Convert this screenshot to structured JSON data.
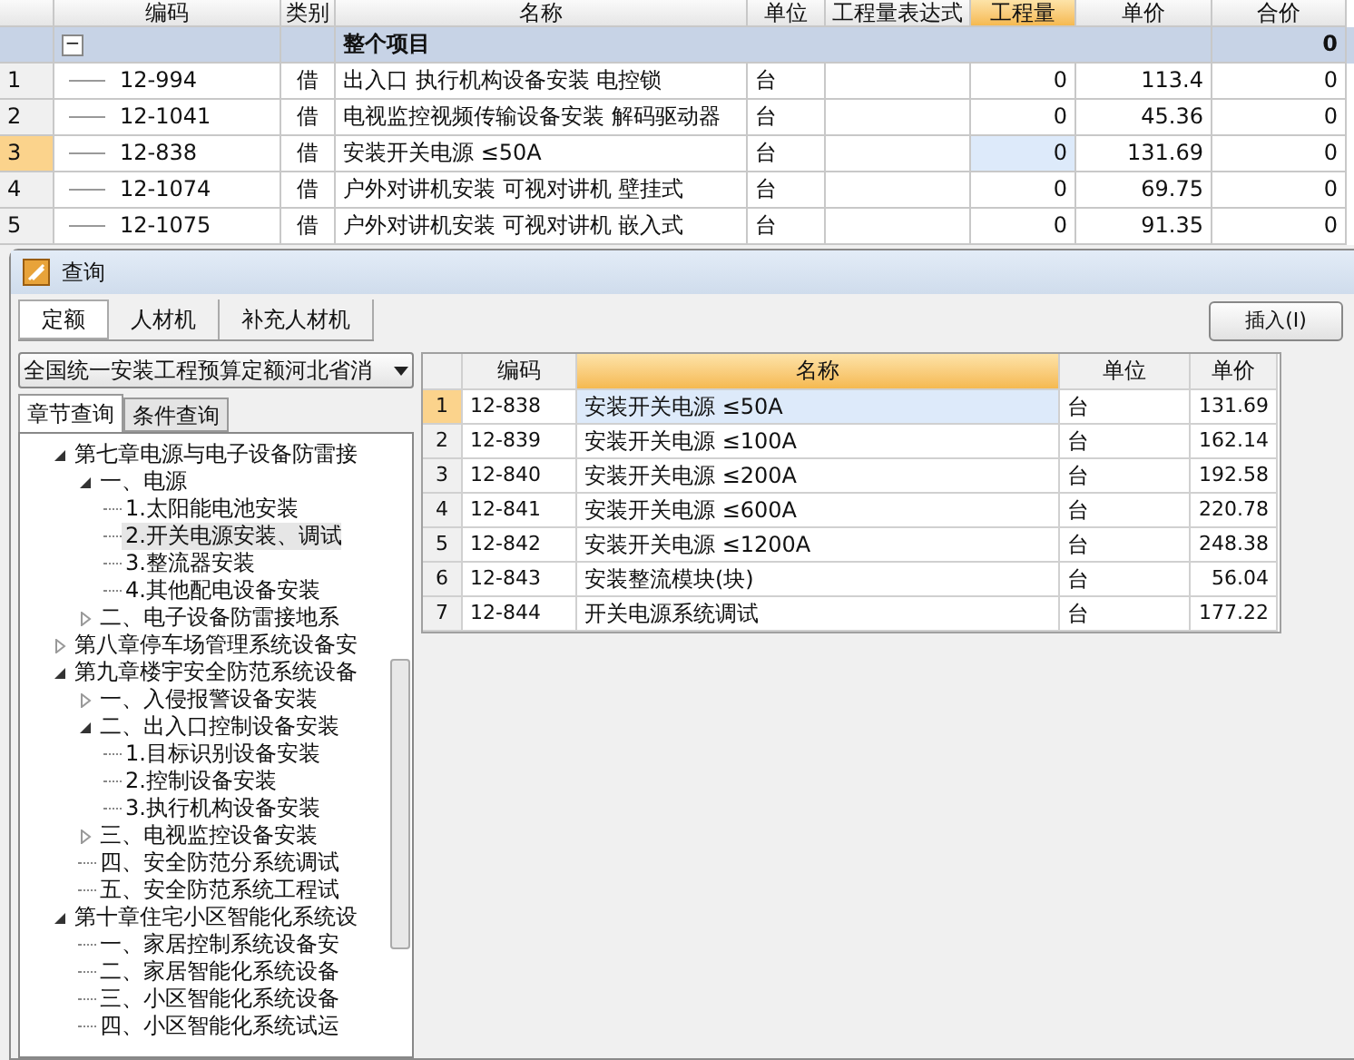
{
  "project_table": {
    "columns": [
      {
        "label": "编码",
        "selected": false
      },
      {
        "label": "类别",
        "selected": false
      },
      {
        "label": "名称",
        "selected": false
      },
      {
        "label": "单位",
        "selected": false
      },
      {
        "label": "工程量表达式",
        "selected": false
      },
      {
        "label": "工程量",
        "selected": true
      },
      {
        "label": "单价",
        "selected": false
      },
      {
        "label": "合价",
        "selected": false
      }
    ],
    "group": {
      "toggle": "−",
      "name": "整个项目",
      "total": "0"
    },
    "rows": [
      {
        "num": "1",
        "code": "12-994",
        "type": "借",
        "name": "出入口 执行机构设备安装 电控锁",
        "unit": "台",
        "qty": "0",
        "price": "113.4",
        "total": "0",
        "selected": false
      },
      {
        "num": "2",
        "code": "12-1041",
        "type": "借",
        "name": "电视监控视频传输设备安装 解码驱动器",
        "unit": "台",
        "qty": "0",
        "price": "45.36",
        "total": "0",
        "selected": false
      },
      {
        "num": "3",
        "code": "12-838",
        "type": "借",
        "name": "安装开关电源 ≤50A",
        "unit": "台",
        "qty": "0",
        "price": "131.69",
        "total": "0",
        "selected": true
      },
      {
        "num": "4",
        "code": "12-1074",
        "type": "借",
        "name": "户外对讲机安装 可视对讲机 壁挂式",
        "unit": "台",
        "qty": "0",
        "price": "69.75",
        "total": "0",
        "selected": false
      },
      {
        "num": "5",
        "code": "12-1075",
        "type": "借",
        "name": "户外对讲机安装 可视对讲机 嵌入式",
        "unit": "台",
        "qty": "0",
        "price": "91.35",
        "total": "0",
        "selected": false
      }
    ]
  },
  "dialog": {
    "title": "查询",
    "tabs": [
      {
        "label": "定额",
        "selected": true
      },
      {
        "label": "人材机",
        "selected": false
      },
      {
        "label": "补充人材机",
        "selected": false
      }
    ],
    "insert_button": "插入(I)",
    "library": "全国统一安装工程预算定额河北省消",
    "query_tabs": [
      {
        "label": "章节查询",
        "selected": true
      },
      {
        "label": "条件查询",
        "selected": false
      }
    ],
    "tree": [
      {
        "label": "第七章电源与电子设备防雷接",
        "expanded": true,
        "children": [
          {
            "label": "一、电源",
            "expanded": true,
            "children": [
              {
                "label": "1.太阳能电池安装",
                "selected": false
              },
              {
                "label": "2.开关电源安装、调试",
                "selected": true
              },
              {
                "label": "3.整流器安装",
                "selected": false
              },
              {
                "label": "4.其他配电设备安装",
                "selected": false
              }
            ]
          },
          {
            "label": "二、电子设备防雷接地系",
            "expanded": false
          }
        ]
      },
      {
        "label": "第八章停车场管理系统设备安",
        "expanded": false
      },
      {
        "label": "第九章楼宇安全防范系统设备",
        "expanded": true,
        "children": [
          {
            "label": "一、入侵报警设备安装",
            "expanded": false
          },
          {
            "label": "二、出入口控制设备安装",
            "expanded": true,
            "children": [
              {
                "label": "1.目标识别设备安装",
                "selected": false
              },
              {
                "label": "2.控制设备安装",
                "selected": false
              },
              {
                "label": "3.执行机构设备安装",
                "selected": false
              }
            ]
          },
          {
            "label": "三、电视监控设备安装",
            "expanded": false
          },
          {
            "label": "四、安全防范分系统调试",
            "selected": false
          },
          {
            "label": "五、安全防范系统工程试",
            "selected": false
          }
        ]
      },
      {
        "label": "第十章住宅小区智能化系统设",
        "expanded": true,
        "children": [
          {
            "label": "一、家居控制系统设备安",
            "selected": false
          },
          {
            "label": "二、家居智能化系统设备",
            "selected": false
          },
          {
            "label": "三、小区智能化系统设备",
            "selected": false
          },
          {
            "label": "四、小区智能化系统试运",
            "selected": false
          }
        ]
      }
    ],
    "results": {
      "columns": [
        {
          "label": "编码",
          "selected": false
        },
        {
          "label": "名称",
          "selected": true
        },
        {
          "label": "单位",
          "selected": false
        },
        {
          "label": "单价",
          "selected": false
        }
      ],
      "rows": [
        {
          "num": "1",
          "code": "12-838",
          "name": "安装开关电源 ≤50A",
          "unit": "台",
          "price": "131.69",
          "selected": true
        },
        {
          "num": "2",
          "code": "12-839",
          "name": "安装开关电源 ≤100A",
          "unit": "台",
          "price": "162.14",
          "selected": false
        },
        {
          "num": "3",
          "code": "12-840",
          "name": "安装开关电源 ≤200A",
          "unit": "台",
          "price": "192.58",
          "selected": false
        },
        {
          "num": "4",
          "code": "12-841",
          "name": "安装开关电源 ≤600A",
          "unit": "台",
          "price": "220.78",
          "selected": false
        },
        {
          "num": "5",
          "code": "12-842",
          "name": "安装开关电源 ≤1200A",
          "unit": "台",
          "price": "248.38",
          "selected": false
        },
        {
          "num": "6",
          "code": "12-843",
          "name": "安装整流模块(块)",
          "unit": "台",
          "price": "56.04",
          "selected": false
        },
        {
          "num": "7",
          "code": "12-844",
          "name": "开关电源系统调试",
          "unit": "台",
          "price": "177.22",
          "selected": false
        }
      ]
    }
  }
}
